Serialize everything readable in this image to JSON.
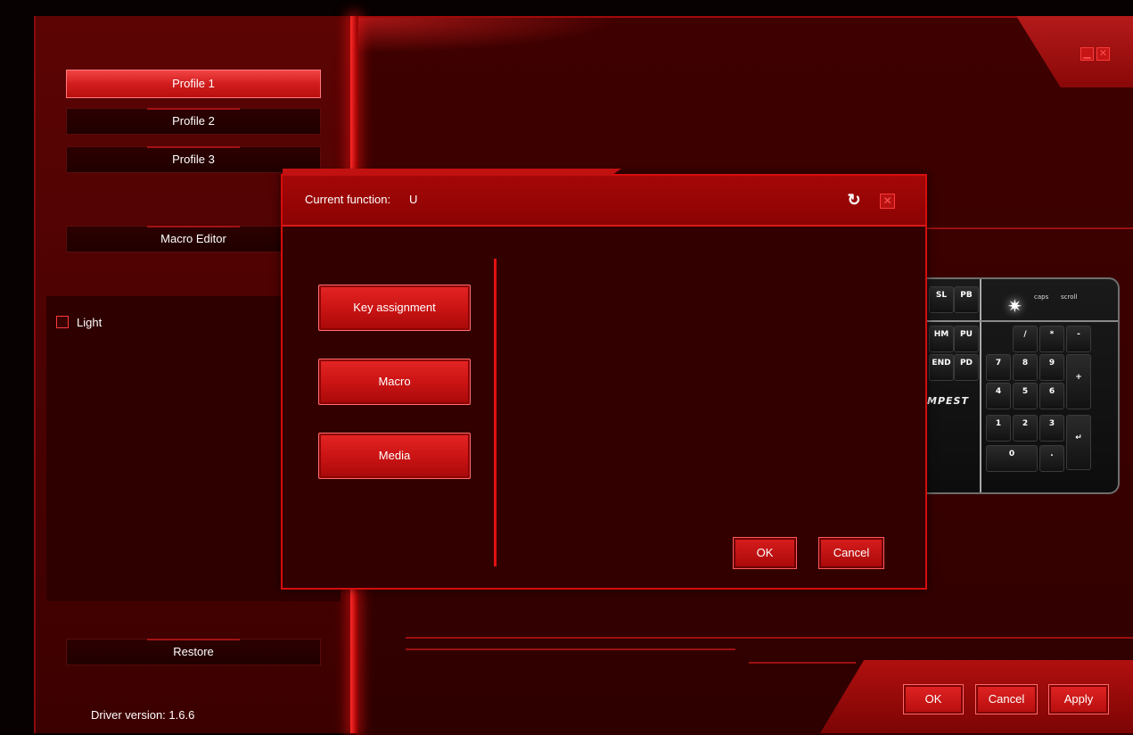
{
  "sidebar": {
    "profiles": [
      {
        "label": "Profile 1",
        "active": true
      },
      {
        "label": "Profile 2",
        "active": false
      },
      {
        "label": "Profile 3",
        "active": false
      }
    ],
    "macro_editor_label": "Macro Editor",
    "light_label": "Light",
    "light_checked": false,
    "restore_label": "Restore",
    "driver_version": "Driver version:  1.6.6"
  },
  "main": {
    "ok_label": "OK",
    "cancel_label": "Cancel",
    "apply_label": "Apply"
  },
  "keyboard": {
    "brand": "MPEST",
    "indicators": [
      "caps",
      "scroll"
    ],
    "keys": [
      "SL",
      "PB",
      "HM",
      "PU",
      "END",
      "PD",
      "/",
      "*",
      "-",
      "7",
      "8",
      "9",
      "+",
      "4",
      "5",
      "6",
      "1",
      "2",
      "3",
      "0",
      "."
    ]
  },
  "dialog": {
    "current_function_label": "Current function:",
    "current_function_value": "U",
    "function_buttons": [
      "Key assignment",
      "Macro",
      "Media"
    ],
    "ok_label": "OK",
    "cancel_label": "Cancel",
    "close_icon": "close-icon",
    "refresh_icon": "refresh-icon"
  },
  "colors": {
    "accent": "#d50d0d",
    "active_button": "#e23232",
    "background": "#3a0000"
  }
}
